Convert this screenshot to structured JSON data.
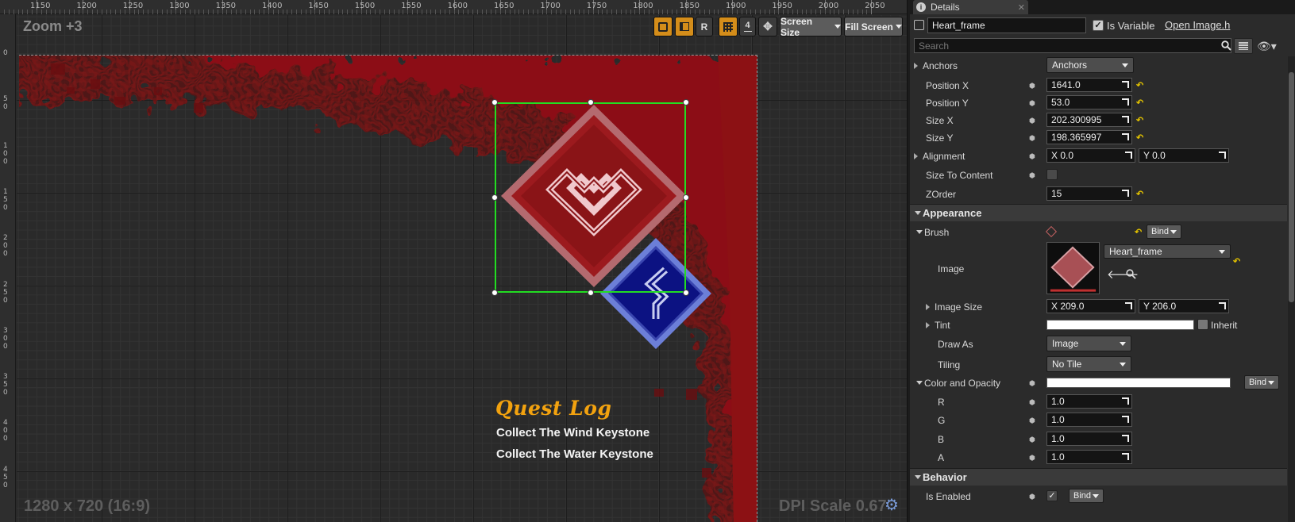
{
  "designer": {
    "zoom_label": "Zoom +3",
    "resolution_label": "1280 x 720 (16:9)",
    "dpi_label": "DPI Scale 0.67",
    "ruler_x": [
      "1150",
      "1200",
      "1250",
      "1300",
      "1350",
      "1400",
      "1450",
      "1500",
      "1550",
      "1600",
      "1650",
      "1700",
      "1750",
      "1800",
      "1850",
      "1900",
      "1950",
      "2000",
      "2050"
    ],
    "ruler_y": [
      "0",
      "50",
      "100",
      "150",
      "200",
      "250",
      "300",
      "350",
      "400",
      "450"
    ],
    "toolbar": {
      "r_label": "R",
      "snap_value": "4",
      "screen_size_label": "Screen Size",
      "fill_screen_label": "Fill Screen"
    },
    "quest": {
      "title": "Quest Log",
      "items": [
        "Collect The Wind Keystone",
        "Collect The Water Keystone"
      ]
    }
  },
  "details": {
    "tab_label": "Details",
    "widget_name": "Heart_frame",
    "is_variable_label": "Is Variable",
    "open_image_label": "Open Image.h",
    "search_placeholder": "Search",
    "properties": {
      "anchors_label": "Anchors",
      "anchors_value": "Anchors",
      "position_x_label": "Position X",
      "position_x": "1641.0",
      "position_y_label": "Position Y",
      "position_y": "53.0",
      "size_x_label": "Size X",
      "size_x": "202.300995",
      "size_y_label": "Size Y",
      "size_y": "198.365997",
      "alignment_label": "Alignment",
      "alignment_x": "X  0.0",
      "alignment_y": "Y  0.0",
      "size_to_content_label": "Size To Content",
      "zorder_label": "ZOrder",
      "zorder": "15"
    },
    "appearance": {
      "section_label": "Appearance",
      "brush_label": "Brush",
      "bind_label": "Bind",
      "image_label": "Image",
      "image_asset": "Heart_frame",
      "image_size_label": "Image Size",
      "image_size_x": "X  209.0",
      "image_size_y": "Y  206.0",
      "tint_label": "Tint",
      "inherit_label": "Inherit",
      "draw_as_label": "Draw As",
      "draw_as_value": "Image",
      "tiling_label": "Tiling",
      "tiling_value": "No Tile",
      "color_opacity_label": "Color and Opacity",
      "r_label": "R",
      "r_value": "1.0",
      "g_label": "G",
      "g_value": "1.0",
      "b_label": "B",
      "b_value": "1.0",
      "a_label": "A",
      "a_value": "1.0"
    },
    "behavior": {
      "section_label": "Behavior",
      "is_enabled_label": "Is Enabled"
    }
  },
  "colors": {
    "selection": "#22dd22",
    "accent_orange": "#d48d1a",
    "quest_title": "#f2a20f",
    "blood_red": "#8c1114",
    "heart_diamond": "#9c1a1e",
    "water_diamond": "#0c1282"
  }
}
